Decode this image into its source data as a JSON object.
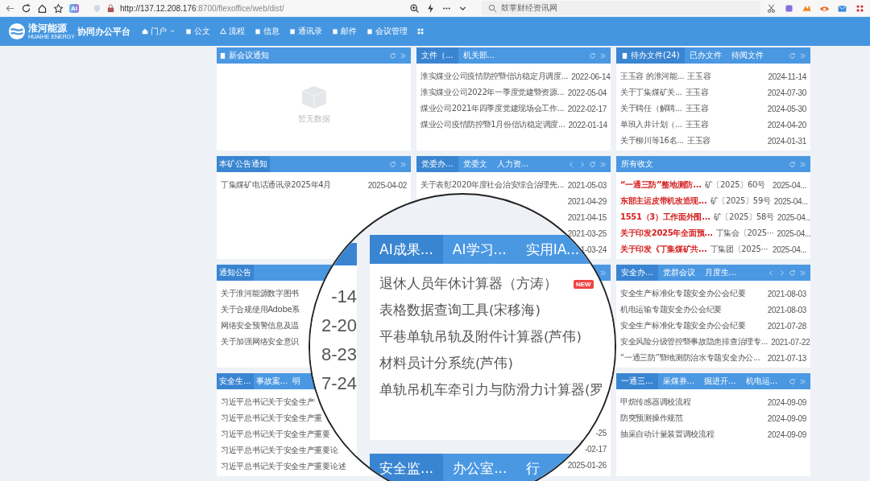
{
  "browser": {
    "url_host": "http://137.12.208.176",
    "url_rest": ":8700/flexoffice/web/dist/",
    "ai_badge": "AI",
    "search": "鼓掌财经资讯网"
  },
  "nav": {
    "logo_cn": "淮河能源",
    "logo_en": "HUAIHE ENERGY",
    "platform": "协同办公平台",
    "items": [
      {
        "label": "门户",
        "dropdown": true
      },
      {
        "label": "公文",
        "dropdown": false
      },
      {
        "label": "流程",
        "dropdown": false
      },
      {
        "label": "信息",
        "dropdown": false
      },
      {
        "label": "通讯录",
        "dropdown": false
      },
      {
        "label": "邮件",
        "dropdown": false
      },
      {
        "label": "会议管理",
        "dropdown": false
      }
    ]
  },
  "columns": [
    [
      {
        "kind": "empty",
        "pager": false,
        "tabs": [
          {
            "label": "新会议通知",
            "selected": false,
            "icon": true
          }
        ],
        "empty_text": "暂无数据"
      },
      {
        "kind": "list",
        "pager": false,
        "tabs": [
          {
            "label": "本矿公告通知",
            "selected": true,
            "icon": false
          }
        ],
        "items": [
          {
            "title": "丁集煤矿电话通讯录2025年4月",
            "date": "2025-04-02"
          }
        ]
      },
      {
        "kind": "list",
        "pager": false,
        "tabs": [
          {
            "label": "通知公告",
            "selected": true,
            "icon": false
          }
        ],
        "items": [
          {
            "title": "关于淮河能源数字图书"
          },
          {
            "title": "关于合规使用Adobe系"
          },
          {
            "title": "网络安全预警信息及温"
          },
          {
            "title": "关于加强网络安全意识"
          }
        ]
      },
      {
        "kind": "list",
        "pager": false,
        "tabs": [
          {
            "label": "安全生...",
            "selected": true,
            "icon": false
          },
          {
            "label": "事故案...",
            "selected": false,
            "icon": false
          },
          {
            "label": "明",
            "selected": false,
            "icon": false
          }
        ],
        "items": [
          {
            "title": "习近平总书记关于安全生产"
          },
          {
            "title": "习近平总书记关于安全生产重"
          },
          {
            "title": "习近平总书记关于安全生产重要"
          },
          {
            "title": "习近平总书记关于安全生产重要论"
          },
          {
            "title": "习近平总书记关于安全生产重要论述"
          }
        ]
      }
    ],
    [
      {
        "kind": "list",
        "pager": false,
        "tabs": [
          {
            "label": "文件（...",
            "selected": true,
            "icon": false
          },
          {
            "label": "机关部...",
            "selected": false,
            "icon": false
          }
        ],
        "items": [
          {
            "title": "淮实煤业公司疫情防控暨信访稳定月调度...",
            "date": "2022-06-14"
          },
          {
            "title": "淮实煤业公司2022年一季度党建暨资源...",
            "date": "2022-05-04"
          },
          {
            "title": "煤业公司2021年四季度党建现场会工作...",
            "date": "2022-02-17"
          },
          {
            "title": "煤业公司疫情防控暨1月份信访稳定调度...",
            "date": "2022-01-14"
          }
        ]
      },
      {
        "kind": "list",
        "pager": true,
        "tabs": [
          {
            "label": "党委办...",
            "selected": true,
            "icon": false
          },
          {
            "label": "党委文",
            "selected": false,
            "icon": false
          },
          {
            "label": "人力资...",
            "selected": false,
            "icon": false
          }
        ],
        "items": [
          {
            "title": "关于表彰2020年度社会治安综合治理先...",
            "date": "2021-05-03"
          },
          {
            "date": "2021-04-29"
          },
          {
            "date": "2021-04-15"
          },
          {
            "date": "2021-03-25"
          },
          {
            "date": "1-03-24"
          }
        ]
      },
      {
        "kind": "list"
      },
      {
        "kind": "list",
        "items": [
          {
            "date": "-25"
          },
          {
            "date": "-02-17"
          },
          {
            "date": "2025-01-26"
          }
        ]
      }
    ],
    [
      {
        "kind": "list",
        "pager": false,
        "tabs": [
          {
            "label": "待办文件(24)",
            "selected": true,
            "icon": true
          },
          {
            "label": "已办文件",
            "selected": false,
            "icon": false
          },
          {
            "label": "待阅文件",
            "selected": false,
            "icon": false
          }
        ],
        "items": [
          {
            "title": "王玉容 的淮河能...",
            "meta": "王玉容",
            "date": "2024-11-14"
          },
          {
            "title": "关于丁集煤矿关...",
            "meta": "王玉容",
            "date": "2024-07-30"
          },
          {
            "title": "关于聘任（解聘...",
            "meta": "王玉容",
            "date": "2024-05-30"
          },
          {
            "title": "单班入井计划（...",
            "meta": "王玉容",
            "date": "2024-04-20"
          },
          {
            "title": "关于柳川等16名...",
            "meta": "王玉容",
            "date": "2024-01-31"
          }
        ]
      },
      {
        "kind": "list",
        "pager": false,
        "tabs": [
          {
            "label": "所有收文",
            "selected": false,
            "icon": false
          }
        ],
        "items": [
          {
            "title": "“一通三防”整地测防...",
            "meta": "矿〔2025〕60号",
            "date": "2025-04...",
            "urgent": true
          },
          {
            "title": "东部主运皮带机改造现...",
            "meta": "矿〔2025〕59号",
            "date": "2025-04...",
            "urgent": true
          },
          {
            "title": "1551（3）工作面外围...",
            "meta": "矿〔2025〕58号",
            "date": "2025-04...",
            "urgent": true
          },
          {
            "title": "关于印发2025年全面预...",
            "meta": "丁集会〔2025···",
            "date": "2025-04...",
            "urgent": true
          },
          {
            "title": "关于印发《丁集煤矿共...",
            "meta": "丁集团〔2025···",
            "date": "2025-04...",
            "urgent": true
          }
        ]
      },
      {
        "kind": "list",
        "pager": true,
        "tabs": [
          {
            "label": "安全办...",
            "selected": true,
            "icon": false
          },
          {
            "label": "党群会议",
            "selected": false,
            "icon": false
          },
          {
            "label": "月度生...",
            "selected": false,
            "icon": false
          }
        ],
        "items": [
          {
            "title": "安全生产标准化专题安全办公会纪要",
            "date": "2021-08-03"
          },
          {
            "title": "机电运输专题安全办公会纪要",
            "date": "2021-08-03"
          },
          {
            "title": "安全生产标准化专题安全办公会纪要",
            "date": "2021-07-28"
          },
          {
            "title": "安全风险分级管控暨事故隐患排查治理专...",
            "date": "2021-07-22"
          },
          {
            "title": "“一通三防”暨地测防治水专题安全办公...",
            "date": "2021-07-13"
          }
        ]
      },
      {
        "kind": "list",
        "pager": false,
        "tabs": [
          {
            "label": "一通三...",
            "selected": true,
            "icon": false
          },
          {
            "label": "采煤券...",
            "selected": false,
            "icon": false
          },
          {
            "label": "掘进开...",
            "selected": false,
            "icon": false
          },
          {
            "label": "机电运...",
            "selected": false,
            "icon": false
          }
        ],
        "items": [
          {
            "title": "甲烷传感器调校流程",
            "date": "2024-09-09"
          },
          {
            "title": "防突预测操作规范",
            "date": "2024-09-09"
          },
          {
            "title": "抽采自动计量装置调校流程",
            "date": "2024-09-09"
          }
        ]
      }
    ]
  ],
  "magnifier": {
    "side_dates": [
      "-14",
      "2-20",
      "8-23",
      "7-24"
    ],
    "tabs": [
      {
        "label": "AI成果...",
        "selected": true
      },
      {
        "label": "AI学习...",
        "selected": false
      },
      {
        "label": "实用IA...",
        "selected": false
      }
    ],
    "items": [
      {
        "title": "退休人员年休计算器（方涛）",
        "badge": "NEW"
      },
      {
        "title": "表格数据查询工具(宋移海)"
      },
      {
        "title": "平巷单轨吊轨及附件计算器(芦伟)"
      },
      {
        "title": "材料员计分系统(芦伟)"
      },
      {
        "title": "单轨吊机车牵引力与防滑力计算器(罗"
      }
    ],
    "bottom_tabs": [
      {
        "label": "安全监...",
        "selected": true
      },
      {
        "label": "办公室...",
        "selected": false
      },
      {
        "label": "行",
        "selected": false
      }
    ]
  }
}
